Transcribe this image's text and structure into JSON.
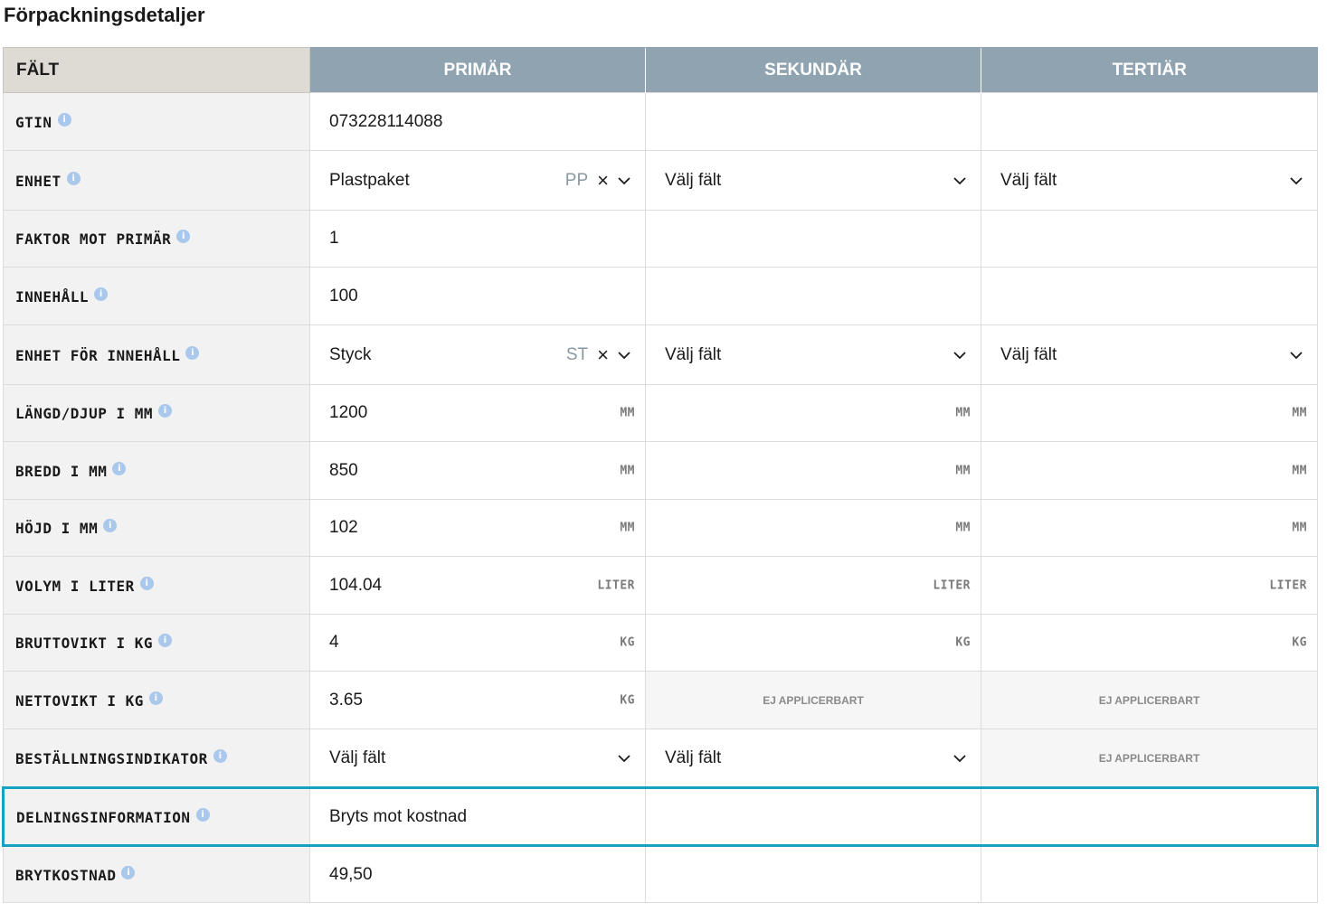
{
  "page": {
    "title": "Förpackningsdetaljer"
  },
  "table": {
    "headers": {
      "field": "FÄLT",
      "primary": "PRIMÄR",
      "secondary": "SEKUNDÄR",
      "tertiary": "TERTIÄR"
    },
    "select_placeholder": "Välj fält",
    "na_text": "EJ APPLICERBART",
    "rows": {
      "gtin": {
        "label": "GTIN",
        "primary": "073228114088"
      },
      "unit": {
        "label": "ENHET",
        "primary": "Plastpaket",
        "primary_code": "PP",
        "secondary": "Välj fält",
        "tertiary": "Välj fält"
      },
      "factor": {
        "label": "FAKTOR MOT PRIMÄR",
        "primary": "1"
      },
      "content": {
        "label": "INNEHÅLL",
        "primary": "100"
      },
      "content_unit": {
        "label": "ENHET FÖR INNEHÅLL",
        "primary": "Styck",
        "primary_code": "ST",
        "secondary": "Välj fält",
        "tertiary": "Välj fält"
      },
      "length": {
        "label": "LÄNGD/DJUP I MM",
        "primary": "1200",
        "unit": "MM"
      },
      "width": {
        "label": "BREDD I MM",
        "primary": "850",
        "unit": "MM"
      },
      "height": {
        "label": "HÖJD I MM",
        "primary": "102",
        "unit": "MM"
      },
      "volume": {
        "label": "VOLYM I LITER",
        "primary": "104.04",
        "unit": "LITER"
      },
      "gross": {
        "label": "BRUTTOVIKT I KG",
        "primary": "4",
        "unit": "KG"
      },
      "net": {
        "label": "NETTOVIKT I KG",
        "primary": "3.65",
        "unit": "KG",
        "secondary": "EJ APPLICERBART",
        "tertiary": "EJ APPLICERBART"
      },
      "order": {
        "label": "BESTÄLLNINGSINDIKATOR",
        "primary": "Välj fält",
        "secondary": "Välj fält",
        "tertiary": "EJ APPLICERBART"
      },
      "split": {
        "label": "DELNINGSINFORMATION",
        "primary": "Bryts mot kostnad"
      },
      "split_cost": {
        "label": "BRYTKOSTNAD",
        "primary": "49,50"
      }
    }
  },
  "icons": {
    "info": "info-icon",
    "clear": "close-icon",
    "dropdown": "chevron-down-icon"
  },
  "colors": {
    "header_bg": "#8fa3b0",
    "field_header_bg": "#dedad4",
    "highlight": "#17a2c0",
    "info": "#a9c8ec"
  }
}
